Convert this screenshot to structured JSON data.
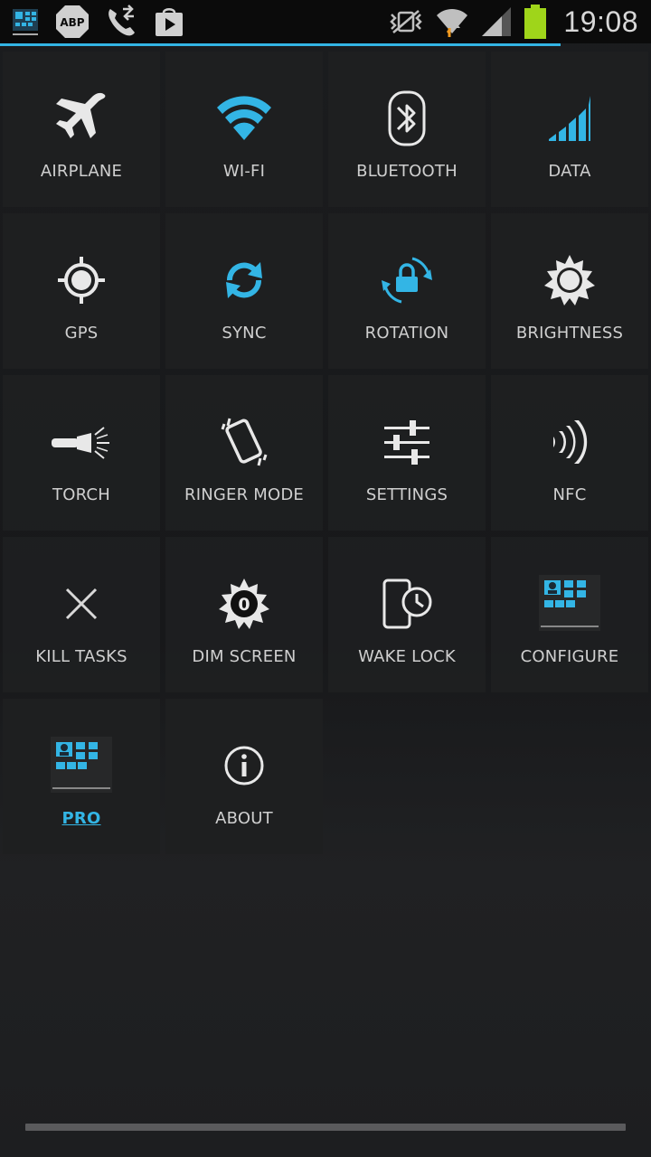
{
  "status_bar": {
    "time": "19:08",
    "left_icons": [
      "widget-icon",
      "adblock-plus-icon",
      "call-forward-icon",
      "play-store-icon"
    ],
    "right_icons": [
      "vibrate-silent-icon",
      "wifi-activity-icon",
      "signal-icon",
      "battery-icon"
    ],
    "adblock_text": "ABP"
  },
  "accent_color": "#33b5e5",
  "tiles": [
    {
      "label": "AIRPLANE",
      "icon": "airplane-icon"
    },
    {
      "label": "WI-FI",
      "icon": "wifi-icon"
    },
    {
      "label": "BLUETOOTH",
      "icon": "bluetooth-icon"
    },
    {
      "label": "DATA",
      "icon": "data-signal-icon"
    },
    {
      "label": "GPS",
      "icon": "gps-icon"
    },
    {
      "label": "SYNC",
      "icon": "sync-icon"
    },
    {
      "label": "ROTATION",
      "icon": "rotation-lock-icon"
    },
    {
      "label": "BRIGHTNESS",
      "icon": "brightness-icon"
    },
    {
      "label": "TORCH",
      "icon": "torch-icon"
    },
    {
      "label": "RINGER MODE",
      "icon": "vibrate-phone-icon"
    },
    {
      "label": "SETTINGS",
      "icon": "sliders-icon"
    },
    {
      "label": "NFC",
      "icon": "nfc-icon"
    },
    {
      "label": "KILL TASKS",
      "icon": "close-icon"
    },
    {
      "label": "DIM SCREEN",
      "icon": "dim-screen-icon",
      "badge": "0"
    },
    {
      "label": "WAKE LOCK",
      "icon": "wake-lock-icon"
    },
    {
      "label": "CONFIGURE",
      "icon": "app-widget-icon"
    },
    {
      "label": "PRO",
      "icon": "app-widget-icon"
    },
    {
      "label": "ABOUT",
      "icon": "info-icon"
    }
  ]
}
